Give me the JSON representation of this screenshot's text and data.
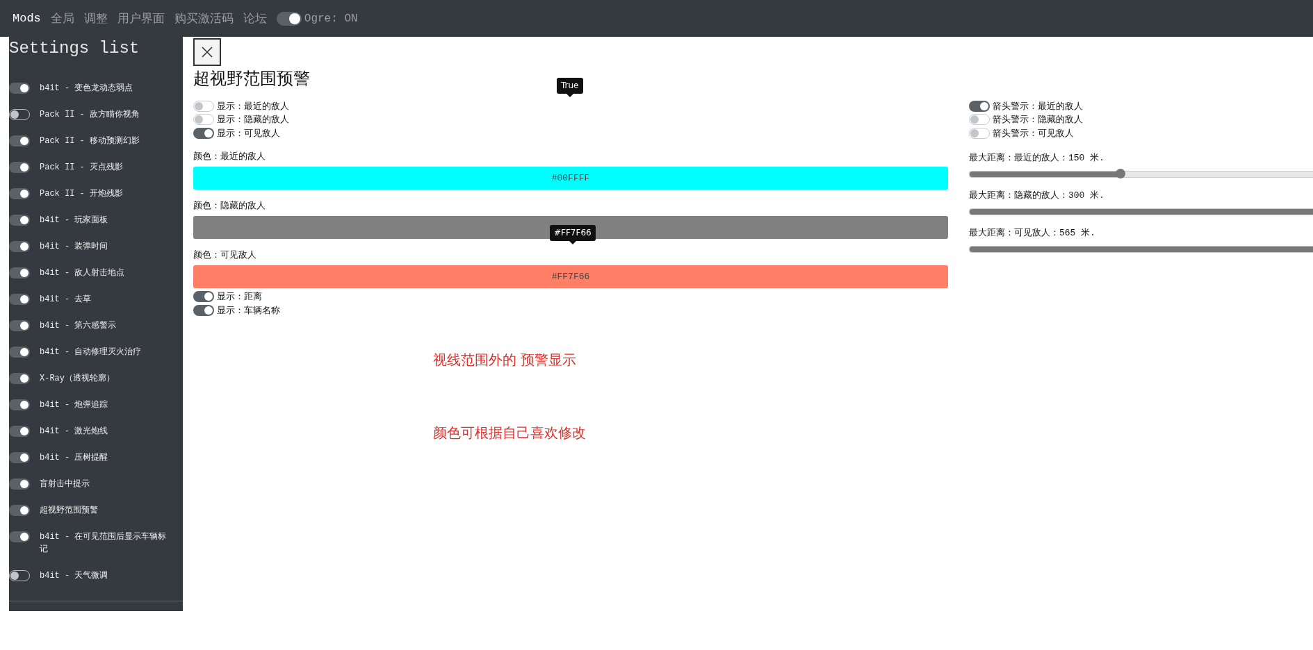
{
  "top_nav": {
    "tabs": [
      {
        "label": "Mods",
        "selected": true
      },
      {
        "label": "全局",
        "selected": false
      },
      {
        "label": "调整",
        "selected": false
      },
      {
        "label": "用户界面",
        "selected": false
      },
      {
        "label": "购买激活码",
        "selected": false
      },
      {
        "label": "论坛",
        "selected": false
      }
    ],
    "toggle": {
      "on": true,
      "label": "Ogre: ON"
    }
  },
  "sidebar": {
    "title": "Settings list",
    "items": [
      {
        "label": "b4it - 变色龙动态弱点",
        "on": true
      },
      {
        "label": "Pack II - 敌方瞄你视角",
        "on": false
      },
      {
        "label": "Pack II - 移动预测幻影",
        "on": true
      },
      {
        "label": "Pack II - 灭点残影",
        "on": true
      },
      {
        "label": "Pack II - 开炮残影",
        "on": true
      },
      {
        "label": "b4it - 玩家面板",
        "on": true
      },
      {
        "label": "b4it - 装弹时间",
        "on": true
      },
      {
        "label": "b4it - 敌人射击地点",
        "on": true
      },
      {
        "label": "b4it - 去草",
        "on": true
      },
      {
        "label": "b4it - 第六感警示",
        "on": true
      },
      {
        "label": "b4it - 自动修理灭火治疗",
        "on": true
      },
      {
        "label": "X-Ray（透视轮廓）",
        "on": true
      },
      {
        "label": "b4it - 炮弹追踪",
        "on": true
      },
      {
        "label": "b4it - 激光炮线",
        "on": true
      },
      {
        "label": "b4it - 压树提醒",
        "on": true
      },
      {
        "label": "盲射击中提示",
        "on": true
      },
      {
        "label": "超视野范围预警",
        "on": true
      },
      {
        "label": "b4it - 在可见范围后显示车辆标记",
        "on": true
      },
      {
        "label": "b4it - 天气微调",
        "on": false
      }
    ]
  },
  "panel": {
    "title": "超视野范围预警",
    "left_toggles": [
      {
        "label": "显示：最近的敌人",
        "on": false
      },
      {
        "label": "显示：隐藏的敌人",
        "on": false
      },
      {
        "label": "显示：可见敌人",
        "on": true
      }
    ],
    "colors": [
      {
        "label": "颜色：最近的敌人",
        "color": "#00ffff",
        "value": "#00FFFF"
      },
      {
        "label": "颜色：隐藏的敌人",
        "color": "#808080"
      },
      {
        "label": "颜色：可见敌人",
        "color": "#ff7f66",
        "value": "#FF7F66"
      }
    ],
    "bottom_toggles": [
      {
        "label": "显示：距离",
        "on": true
      },
      {
        "label": "显示：车辆名称",
        "on": true
      }
    ],
    "tooltips": [
      "True",
      "#FF7F66"
    ],
    "right_toggles": [
      {
        "label": "箭头警示：最近的敌人",
        "on": true
      },
      {
        "label": "箭头警示：隐藏的敌人",
        "on": false
      },
      {
        "label": "箭头警示：可见敌人",
        "on": false
      }
    ],
    "sliders": [
      {
        "label": "最大距离：最近的敌人：150 米.",
        "level": 0.44
      },
      {
        "label": "最大距离：隐藏的敌人：300 米.",
        "level": 1
      },
      {
        "label": "最大距离：可见敌人：565 米.",
        "level": 1
      }
    ],
    "notes": [
      "视线范围外的 预警显示",
      "颜色可根据自己喜欢修改"
    ]
  }
}
